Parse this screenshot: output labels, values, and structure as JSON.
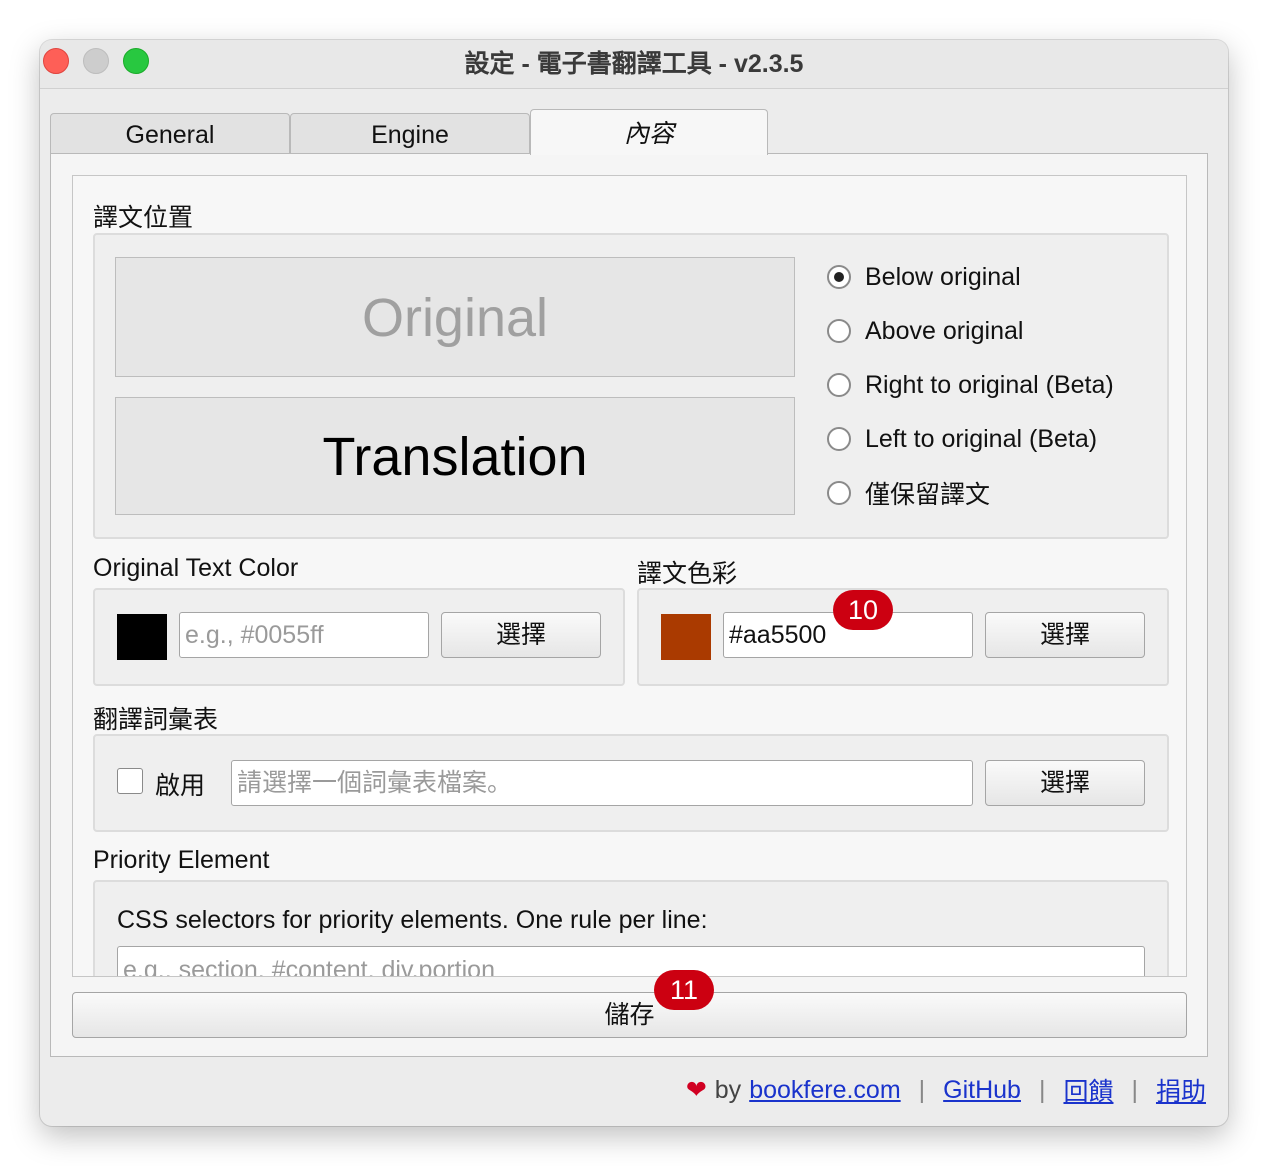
{
  "window": {
    "title": "設定 - 電子書翻譯工具 - v2.3.5"
  },
  "tabs": [
    {
      "label": "General"
    },
    {
      "label": "Engine"
    },
    {
      "label": "內容"
    }
  ],
  "position_section": {
    "title": "譯文位置",
    "preview_original": "Original",
    "preview_translation": "Translation",
    "options": [
      {
        "label": "Below original",
        "selected": true
      },
      {
        "label": "Above original",
        "selected": false
      },
      {
        "label": "Right to original (Beta)",
        "selected": false
      },
      {
        "label": "Left to original (Beta)",
        "selected": false
      },
      {
        "label": "僅保留譯文",
        "selected": false
      }
    ]
  },
  "original_color": {
    "title": "Original Text Color",
    "swatch_color": "#000000",
    "placeholder": "e.g., #0055ff",
    "value": "",
    "button": "選擇"
  },
  "translation_color": {
    "title": "譯文色彩",
    "swatch_color": "#aa3a00",
    "value": "#aa5500",
    "button": "選擇"
  },
  "glossary": {
    "title": "翻譯詞彙表",
    "enable_label": "啟用",
    "enabled": false,
    "placeholder": "請選擇一個詞彙表檔案。",
    "button": "選擇"
  },
  "priority": {
    "title": "Priority Element",
    "description": "CSS selectors for priority elements. One rule per line:",
    "placeholder": "e.g., section, #content, div.portion"
  },
  "save_button": "儲存",
  "badges": [
    "10",
    "11"
  ],
  "footer": {
    "heart": "❤",
    "by": "by",
    "site": "bookfere.com",
    "github": "GitHub",
    "feedback": "回饋",
    "donate": "捐助",
    "separator": "|"
  }
}
